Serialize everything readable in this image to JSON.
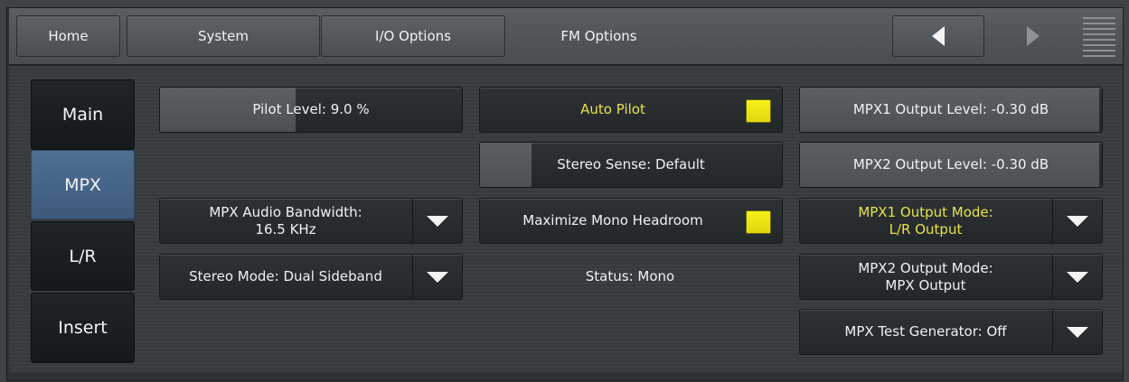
{
  "tabs": {
    "home": "Home",
    "system": "System",
    "io_options": "I/O Options",
    "fm_options": "FM Options"
  },
  "sidebar": {
    "items": [
      "Main",
      "MPX",
      "L/R",
      "Insert"
    ],
    "active": "MPX"
  },
  "controls": {
    "pilot_level": {
      "label": "Pilot Level: 9.0 %",
      "value_percent": 9.0
    },
    "auto_pilot": {
      "label": "Auto Pilot",
      "checked": true
    },
    "mpx1_output_level": {
      "label": "MPX1 Output Level: -0.30 dB"
    },
    "stereo_sense": {
      "label": "Stereo Sense: Default"
    },
    "mpx2_output_level": {
      "label": "MPX2 Output Level: -0.30 dB"
    },
    "mpx_audio_bandwidth": {
      "line1": "MPX Audio Bandwidth:",
      "line2": "16.5 KHz"
    },
    "maximize_mono_headroom": {
      "label": "Maximize Mono Headroom",
      "checked": true
    },
    "mpx1_output_mode": {
      "line1": "MPX1 Output Mode:",
      "line2": "L/R Output"
    },
    "stereo_mode": {
      "label": "Stereo Mode: Dual Sideband"
    },
    "status": "Status: Mono",
    "mpx2_output_mode": {
      "line1": "MPX2 Output Mode:",
      "line2": "MPX Output"
    },
    "mpx_test_generator": {
      "label": "MPX Test Generator: Off"
    }
  },
  "colors": {
    "highlight_text": "#e7e24a",
    "checkbox_yellow": "#f7f01a",
    "active_side": "#4f6f93"
  },
  "icons": {
    "nav_back": "left-triangle",
    "nav_forward": "right-triangle",
    "menu": "horizontal-lines",
    "dropdown": "down-triangle"
  }
}
